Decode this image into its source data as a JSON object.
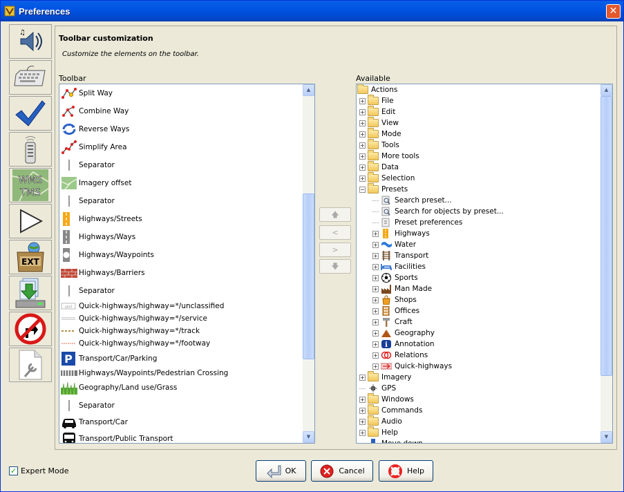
{
  "window": {
    "title": "Preferences",
    "close_glyph": "✕"
  },
  "sidebar": {
    "tabs": [
      {
        "name": "sound",
        "icon": "speaker-icon"
      },
      {
        "name": "keyboard",
        "icon": "keyboard-icon"
      },
      {
        "name": "validator",
        "icon": "checkmark-icon"
      },
      {
        "name": "remote-control",
        "icon": "remote-icon"
      },
      {
        "name": "imagery",
        "icon": "wms-tms-icon",
        "text": "WMS\nTMS"
      },
      {
        "name": "draw",
        "icon": "triangle-icon"
      },
      {
        "name": "plugins",
        "icon": "ext-icon",
        "text": "EXT"
      },
      {
        "name": "download",
        "icon": "download-icon"
      },
      {
        "name": "shortcuts",
        "icon": "no-turn-icon"
      },
      {
        "name": "advanced",
        "icon": "document-wrench-icon"
      }
    ]
  },
  "header": {
    "title": "Toolbar customization",
    "description": "Customize the elements on the toolbar."
  },
  "toolbar_list": {
    "label": "Toolbar",
    "items": [
      {
        "text": "Split Way",
        "icon": "split-way-icon"
      },
      {
        "text": "Combine Way",
        "icon": "combine-way-icon"
      },
      {
        "text": "Reverse Ways",
        "icon": "reverse-ways-icon"
      },
      {
        "text": "Simplify Area",
        "icon": "simplify-area-icon"
      },
      {
        "text": "Separator",
        "icon": "separator-icon"
      },
      {
        "text": "Imagery offset",
        "icon": "imagery-offset-icon"
      },
      {
        "text": "Separator",
        "icon": "separator-icon"
      },
      {
        "text": "Highways/Streets",
        "icon": "highway-streets-icon"
      },
      {
        "text": "Highways/Ways",
        "icon": "highway-ways-icon"
      },
      {
        "text": "Highways/Waypoints",
        "icon": "highway-waypoints-icon"
      },
      {
        "text": "Highways/Barriers",
        "icon": "barrier-icon"
      },
      {
        "text": "Separator",
        "icon": "separator-icon"
      },
      {
        "text": "Quick-highways/highway=*/unclassified",
        "icon": "unclassified-line-icon"
      },
      {
        "text": "Quick-highways/highway=*/service",
        "icon": "service-line-icon"
      },
      {
        "text": "Quick-highways/highway=*/track",
        "icon": "track-line-icon"
      },
      {
        "text": "Quick-highways/highway=*/footway",
        "icon": "footway-line-icon"
      },
      {
        "text": "Transport/Car/Parking",
        "icon": "parking-icon"
      },
      {
        "text": "Highways/Waypoints/Pedestrian Crossing",
        "icon": "crossing-icon"
      },
      {
        "text": "Geography/Land use/Grass",
        "icon": "grass-icon"
      },
      {
        "text": "Separator",
        "icon": "separator-icon"
      },
      {
        "text": "Transport/Car",
        "icon": "car-icon"
      },
      {
        "text": "Transport/Public Transport",
        "icon": "bus-icon"
      }
    ]
  },
  "mid_buttons": {
    "up": "🡅",
    "left": "<",
    "right": ">",
    "down": "🡇"
  },
  "available_tree": {
    "label": "Available",
    "nodes": [
      {
        "text": "Actions",
        "level": 0,
        "pm": "",
        "icon": "folder"
      },
      {
        "text": "File",
        "level": 1,
        "pm": "+",
        "icon": "folder"
      },
      {
        "text": "Edit",
        "level": 1,
        "pm": "+",
        "icon": "folder"
      },
      {
        "text": "View",
        "level": 1,
        "pm": "+",
        "icon": "folder"
      },
      {
        "text": "Mode",
        "level": 1,
        "pm": "+",
        "icon": "folder"
      },
      {
        "text": "Tools",
        "level": 1,
        "pm": "+",
        "icon": "folder"
      },
      {
        "text": "More tools",
        "level": 1,
        "pm": "+",
        "icon": "folder"
      },
      {
        "text": "Data",
        "level": 1,
        "pm": "+",
        "icon": "folder"
      },
      {
        "text": "Selection",
        "level": 1,
        "pm": "+",
        "icon": "folder"
      },
      {
        "text": "Presets",
        "level": 1,
        "pm": "−",
        "icon": "folder"
      },
      {
        "text": "Search preset...",
        "level": 2,
        "pm": "",
        "icon": "search-preset-icon"
      },
      {
        "text": "Search for objects by preset...",
        "level": 2,
        "pm": "",
        "icon": "search-objects-icon"
      },
      {
        "text": "Preset preferences",
        "level": 2,
        "pm": "",
        "icon": "preset-prefs-icon"
      },
      {
        "text": "Highways",
        "level": 2,
        "pm": "+",
        "icon": "highway-icon"
      },
      {
        "text": "Water",
        "level": 2,
        "pm": "+",
        "icon": "water-icon"
      },
      {
        "text": "Transport",
        "level": 2,
        "pm": "+",
        "icon": "railway-icon"
      },
      {
        "text": "Facilities",
        "level": 2,
        "pm": "+",
        "icon": "bed-icon"
      },
      {
        "text": "Sports",
        "level": 2,
        "pm": "+",
        "icon": "soccer-ball-icon"
      },
      {
        "text": "Man Made",
        "level": 2,
        "pm": "+",
        "icon": "factory-icon"
      },
      {
        "text": "Shops",
        "level": 2,
        "pm": "+",
        "icon": "shop-bag-icon"
      },
      {
        "text": "Offices",
        "level": 2,
        "pm": "+",
        "icon": "office-icon"
      },
      {
        "text": "Craft",
        "level": 2,
        "pm": "+",
        "icon": "hammer-icon"
      },
      {
        "text": "Geography",
        "level": 2,
        "pm": "+",
        "icon": "mountain-icon"
      },
      {
        "text": "Annotation",
        "level": 2,
        "pm": "+",
        "icon": "info-icon"
      },
      {
        "text": "Relations",
        "level": 2,
        "pm": "+",
        "icon": "relation-rings-icon"
      },
      {
        "text": "Quick-highways",
        "level": 2,
        "pm": "+",
        "icon": "quick-highway-icon"
      },
      {
        "text": "Imagery",
        "level": 1,
        "pm": "+",
        "icon": "folder"
      },
      {
        "text": "GPS",
        "level": 1,
        "pm": "",
        "icon": "gps-icon"
      },
      {
        "text": "Windows",
        "level": 1,
        "pm": "+",
        "icon": "folder"
      },
      {
        "text": "Commands",
        "level": 1,
        "pm": "+",
        "icon": "folder"
      },
      {
        "text": "Audio",
        "level": 1,
        "pm": "+",
        "icon": "folder"
      },
      {
        "text": "Help",
        "level": 1,
        "pm": "+",
        "icon": "folder"
      },
      {
        "text": "Move down",
        "level": 1,
        "pm": "",
        "icon": "move-down-icon"
      }
    ]
  },
  "footer": {
    "expert_mode_label": "Expert Mode",
    "expert_mode_checked": true,
    "ok_label": "OK",
    "cancel_label": "Cancel",
    "help_label": "Help"
  },
  "colors": {
    "title_bar": "#0054e3",
    "selection": "#316ac5",
    "window_bg": "#ece9d8",
    "scroll_thumb": "#b7cef8"
  }
}
